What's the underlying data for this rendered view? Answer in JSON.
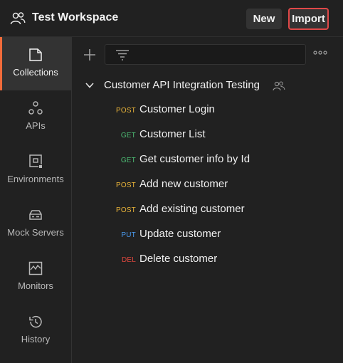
{
  "header": {
    "workspace_icon": "people-icon",
    "workspace_title": "Test Workspace",
    "new_label": "New",
    "import_label": "Import"
  },
  "sidebar": {
    "items": [
      {
        "label": "Collections",
        "icon": "collection-icon",
        "active": true
      },
      {
        "label": "APIs",
        "icon": "api-icon",
        "active": false
      },
      {
        "label": "Environments",
        "icon": "environment-icon",
        "active": false
      },
      {
        "label": "Mock Servers",
        "icon": "server-icon",
        "active": false
      },
      {
        "label": "Monitors",
        "icon": "monitor-icon",
        "active": false
      },
      {
        "label": "History",
        "icon": "history-icon",
        "active": false
      }
    ]
  },
  "collection": {
    "name": "Customer API Integration Testing",
    "requests": [
      {
        "method": "POST",
        "name": "Customer Login"
      },
      {
        "method": "GET",
        "name": "Customer List"
      },
      {
        "method": "GET",
        "name": "Get customer info by Id"
      },
      {
        "method": "POST",
        "name": "Add new customer"
      },
      {
        "method": "POST",
        "name": "Add existing customer"
      },
      {
        "method": "PUT",
        "name": "Update customer"
      },
      {
        "method": "DEL",
        "name": "Delete customer"
      }
    ]
  },
  "colors": {
    "POST": "#e8b339",
    "GET": "#4dbd74",
    "PUT": "#4a9bf0",
    "DEL": "#e0473e",
    "accent": "#f26b3a",
    "highlight": "#e04848"
  }
}
